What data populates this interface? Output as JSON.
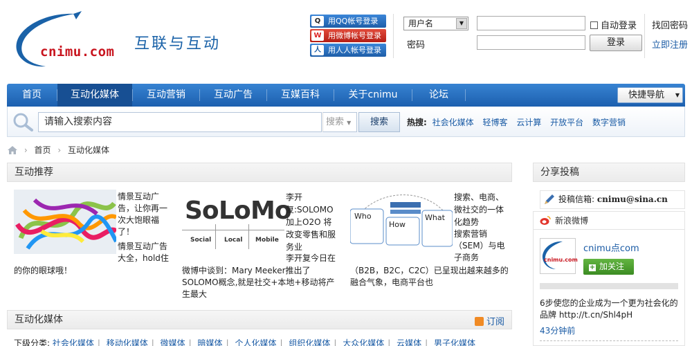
{
  "brand": {
    "logo_text": "cnimu.com",
    "slogan": "互联与互动"
  },
  "oauth": {
    "qq": "用QQ帐号登录",
    "weibo": "用微博帐号登录",
    "renren": "用人人帐号登录"
  },
  "login": {
    "user_select": "用户名",
    "password_label": "密码",
    "auto_login": "自动登录",
    "login_button": "登录",
    "forgot": "找回密码",
    "register": "立即注册"
  },
  "nav": {
    "items": [
      "首页",
      "互动化媒体",
      "互动营销",
      "互动广告",
      "互媒百科",
      "关于cnimu",
      "论坛"
    ],
    "active_index": 1,
    "quick_nav": "快捷导航"
  },
  "search": {
    "placeholder": "请输入搜索内容",
    "type": "搜索",
    "button": "搜索",
    "hot_label": "热搜:",
    "hot_terms": [
      "社会化媒体",
      "轻博客",
      "云计算",
      "开放平台",
      "数字营销"
    ]
  },
  "breadcrumb": [
    "首页",
    "互动化媒体"
  ],
  "recommend": {
    "title": "互动推荐",
    "items": [
      {
        "text": "情景互动广告，让你再一次大饱眼福了！",
        "text2": "情景互动广告大全，hold住",
        "text3": "的你的眼球哦！"
      },
      {
        "image_words": [
          "So",
          "Lo",
          "Mo"
        ],
        "image_subs": [
          "Social",
          "Local",
          "Mobile"
        ],
        "title": "李开复:SOLOMO加上O2O 将改变零售和服务业",
        "text": "李开复今日在",
        "text2": "微博中谈到：Mary Meeker推出了SOLOMO概念,就是社交+本地+移动将产生最大"
      },
      {
        "image_words": [
          "Who",
          "How",
          "What"
        ],
        "title": "搜索、电商、微社交的一体化趋势",
        "text": "搜索营销（SEM）与电子商务",
        "text2": "（B2B，B2C，C2C）已呈现出越来越多的融合气象，电商平台也"
      }
    ]
  },
  "share": {
    "title": "分享投稿",
    "mail_label": "投稿信箱:",
    "mail": "cnimu@sina.cn"
  },
  "weibo": {
    "title": "新浪微博",
    "avatar_text": "cnimu.com",
    "name": "cnimu点com",
    "follow": "加关注",
    "message": "6步使您的企业成为一个更为社会化的品牌 http://t.cn/Shl4pH",
    "time": "43分钟前"
  },
  "media": {
    "title": "互动化媒体",
    "subscribe": "订阅",
    "sub_label": "下级分类:",
    "categories": [
      "社会化媒体",
      "移动化媒体",
      "微媒体",
      "暗媒体",
      "个人化媒体",
      "组织化媒体",
      "大众化媒体",
      "云媒体",
      "男子化媒体"
    ]
  }
}
